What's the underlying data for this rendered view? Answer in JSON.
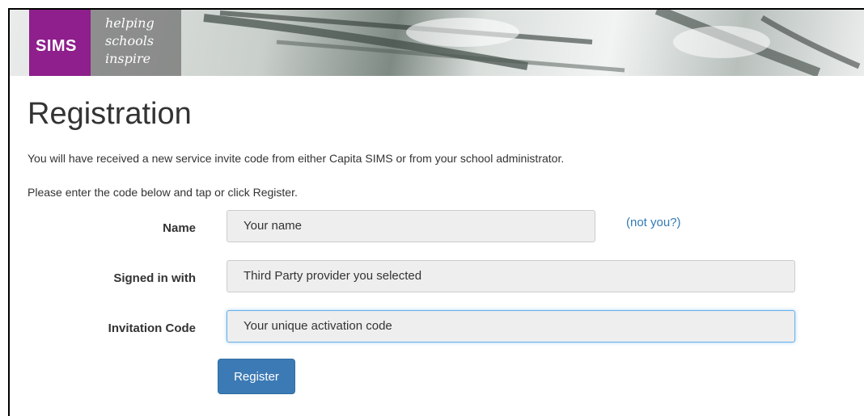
{
  "banner": {
    "logo": "SIMS",
    "tagline": [
      "helping",
      "schools",
      "inspire"
    ]
  },
  "page": {
    "title": "Registration",
    "intro": "You will have received a new service invite code from either Capita SIMS or from your school administrator.",
    "instruction": "Please enter the code below and tap or click Register."
  },
  "form": {
    "name": {
      "label": "Name",
      "value": "Your name",
      "link": "(not you?)"
    },
    "signed_in": {
      "label": "Signed in with",
      "value": "Third Party provider you selected"
    },
    "invitation": {
      "label": "Invitation Code",
      "value": "Your unique activation code"
    },
    "register_label": "Register"
  },
  "colors": {
    "brand": "#8e1f8c",
    "button": "#3c7ab5",
    "link": "#337ab7"
  }
}
